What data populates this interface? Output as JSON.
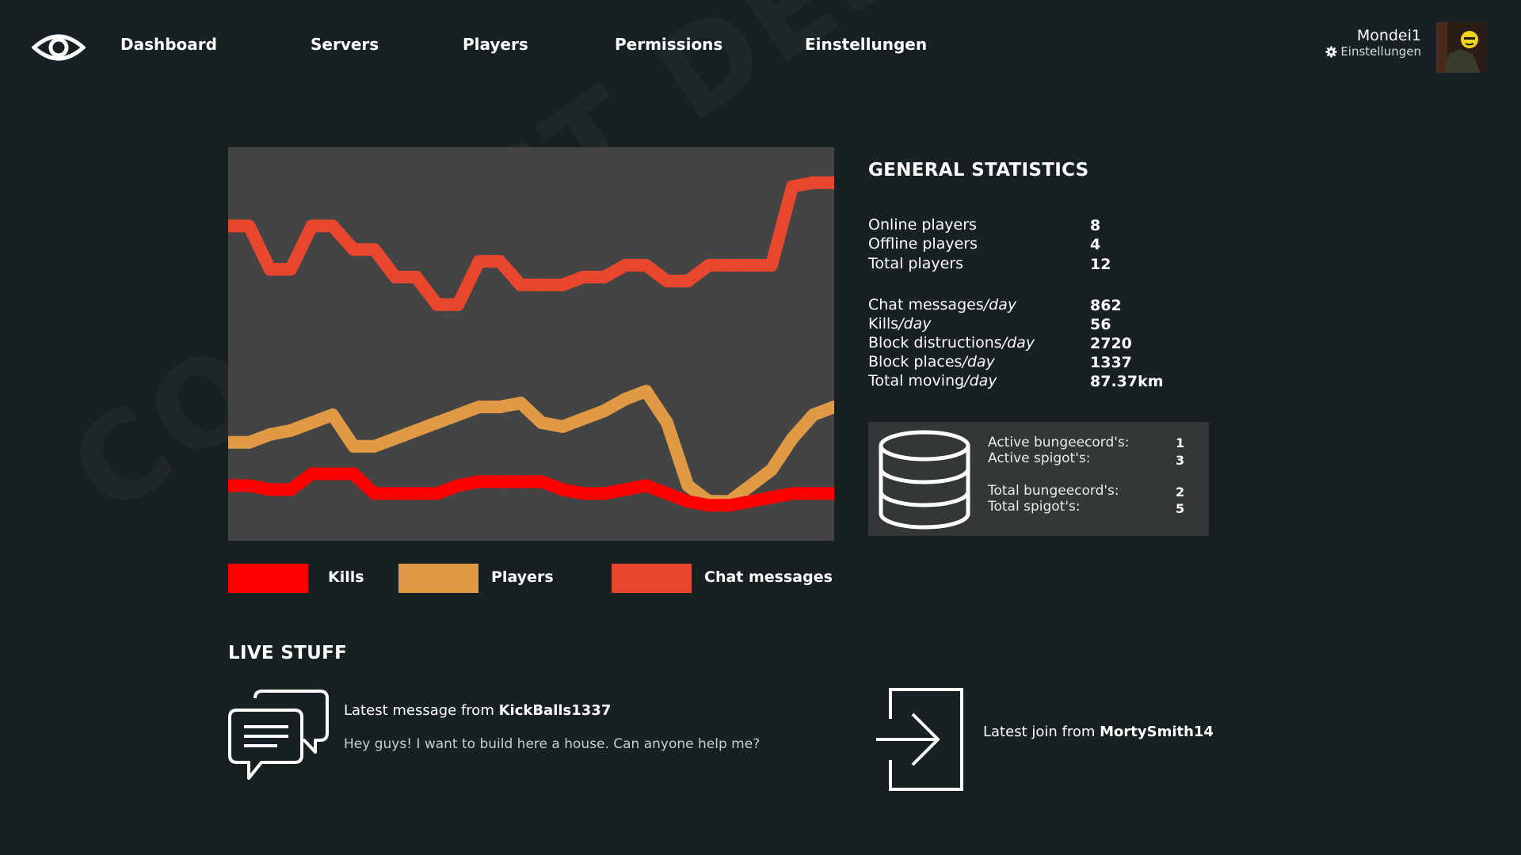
{
  "watermark": "CONCEPT DESIGN",
  "nav": {
    "items": [
      {
        "label": "Dashboard"
      },
      {
        "label": "Servers"
      },
      {
        "label": "Players"
      },
      {
        "label": "Permissions"
      },
      {
        "label": "Einstellungen"
      }
    ]
  },
  "user": {
    "name": "Mondei1",
    "settings_label": "Einstellungen"
  },
  "chart_data": {
    "type": "line",
    "title": "",
    "xlabel": "",
    "ylabel": "",
    "grid": false,
    "legend_position": "bottom",
    "series": [
      {
        "name": "Chat messages",
        "color": "#e8472e",
        "values": [
          80,
          80,
          69,
          69,
          80,
          80,
          74,
          74,
          67,
          67,
          60,
          60,
          71,
          71,
          65,
          65,
          65,
          67,
          67,
          70,
          70,
          66,
          66,
          70,
          70,
          70,
          70,
          90,
          91,
          91
        ]
      },
      {
        "name": "Players",
        "color": "#e09a45",
        "values": [
          25,
          25,
          27,
          28,
          30,
          32,
          24,
          24,
          26,
          28,
          30,
          32,
          34,
          34,
          35,
          30,
          29,
          31,
          33,
          36,
          38,
          30,
          14,
          10,
          10,
          14,
          18,
          26,
          32,
          34
        ]
      },
      {
        "name": "Kills",
        "color": "#ff0000",
        "values": [
          14,
          14,
          13,
          13,
          17,
          17,
          17,
          12,
          12,
          12,
          12,
          14,
          15,
          15,
          15,
          15,
          13,
          12,
          12,
          13,
          14,
          12,
          10,
          9,
          9,
          10,
          11,
          12,
          12,
          12
        ]
      }
    ],
    "ylim": [
      0,
      100
    ]
  },
  "legend": [
    {
      "label": "Kills",
      "color": "#ff0000"
    },
    {
      "label": "Players",
      "color": "#e09a45"
    },
    {
      "label": "Chat messages",
      "color": "#e8472e"
    }
  ],
  "general": {
    "title": "GENERAL STATISTICS",
    "rows": [
      {
        "label": "Online players",
        "suffix": "",
        "value": "8"
      },
      {
        "label": "Offline players",
        "suffix": "",
        "value": "4"
      },
      {
        "label": "Total players",
        "suffix": "",
        "value": "12"
      },
      {
        "label": "Chat messages",
        "suffix": "/day",
        "value": "862"
      },
      {
        "label": "Kills",
        "suffix": "/day",
        "value": "56"
      },
      {
        "label": "Block distructions",
        "suffix": "/day",
        "value": "2720"
      },
      {
        "label": "Block places",
        "suffix": "/day",
        "value": "1337"
      },
      {
        "label": "Total moving",
        "suffix": "/day",
        "value": "87.37km"
      }
    ]
  },
  "servers": {
    "active_bungee_label": "Active bungeecord's:",
    "active_bungee_value": "1",
    "active_spigot_label": "Active spigot's:",
    "active_spigot_value": "3",
    "total_bungee_label": "Total bungeecord's:",
    "total_bungee_value": "2",
    "total_spigot_label": "Total spigot's:",
    "total_spigot_value": "5"
  },
  "live": {
    "title": "LIVE STUFF",
    "message_prefix": "Latest message from ",
    "message_user": "KickBalls1337",
    "message_text": "Hey guys! I want to build here a house. Can anyone help me?",
    "join_prefix": "Latest join from ",
    "join_user": "MortySmith14"
  }
}
